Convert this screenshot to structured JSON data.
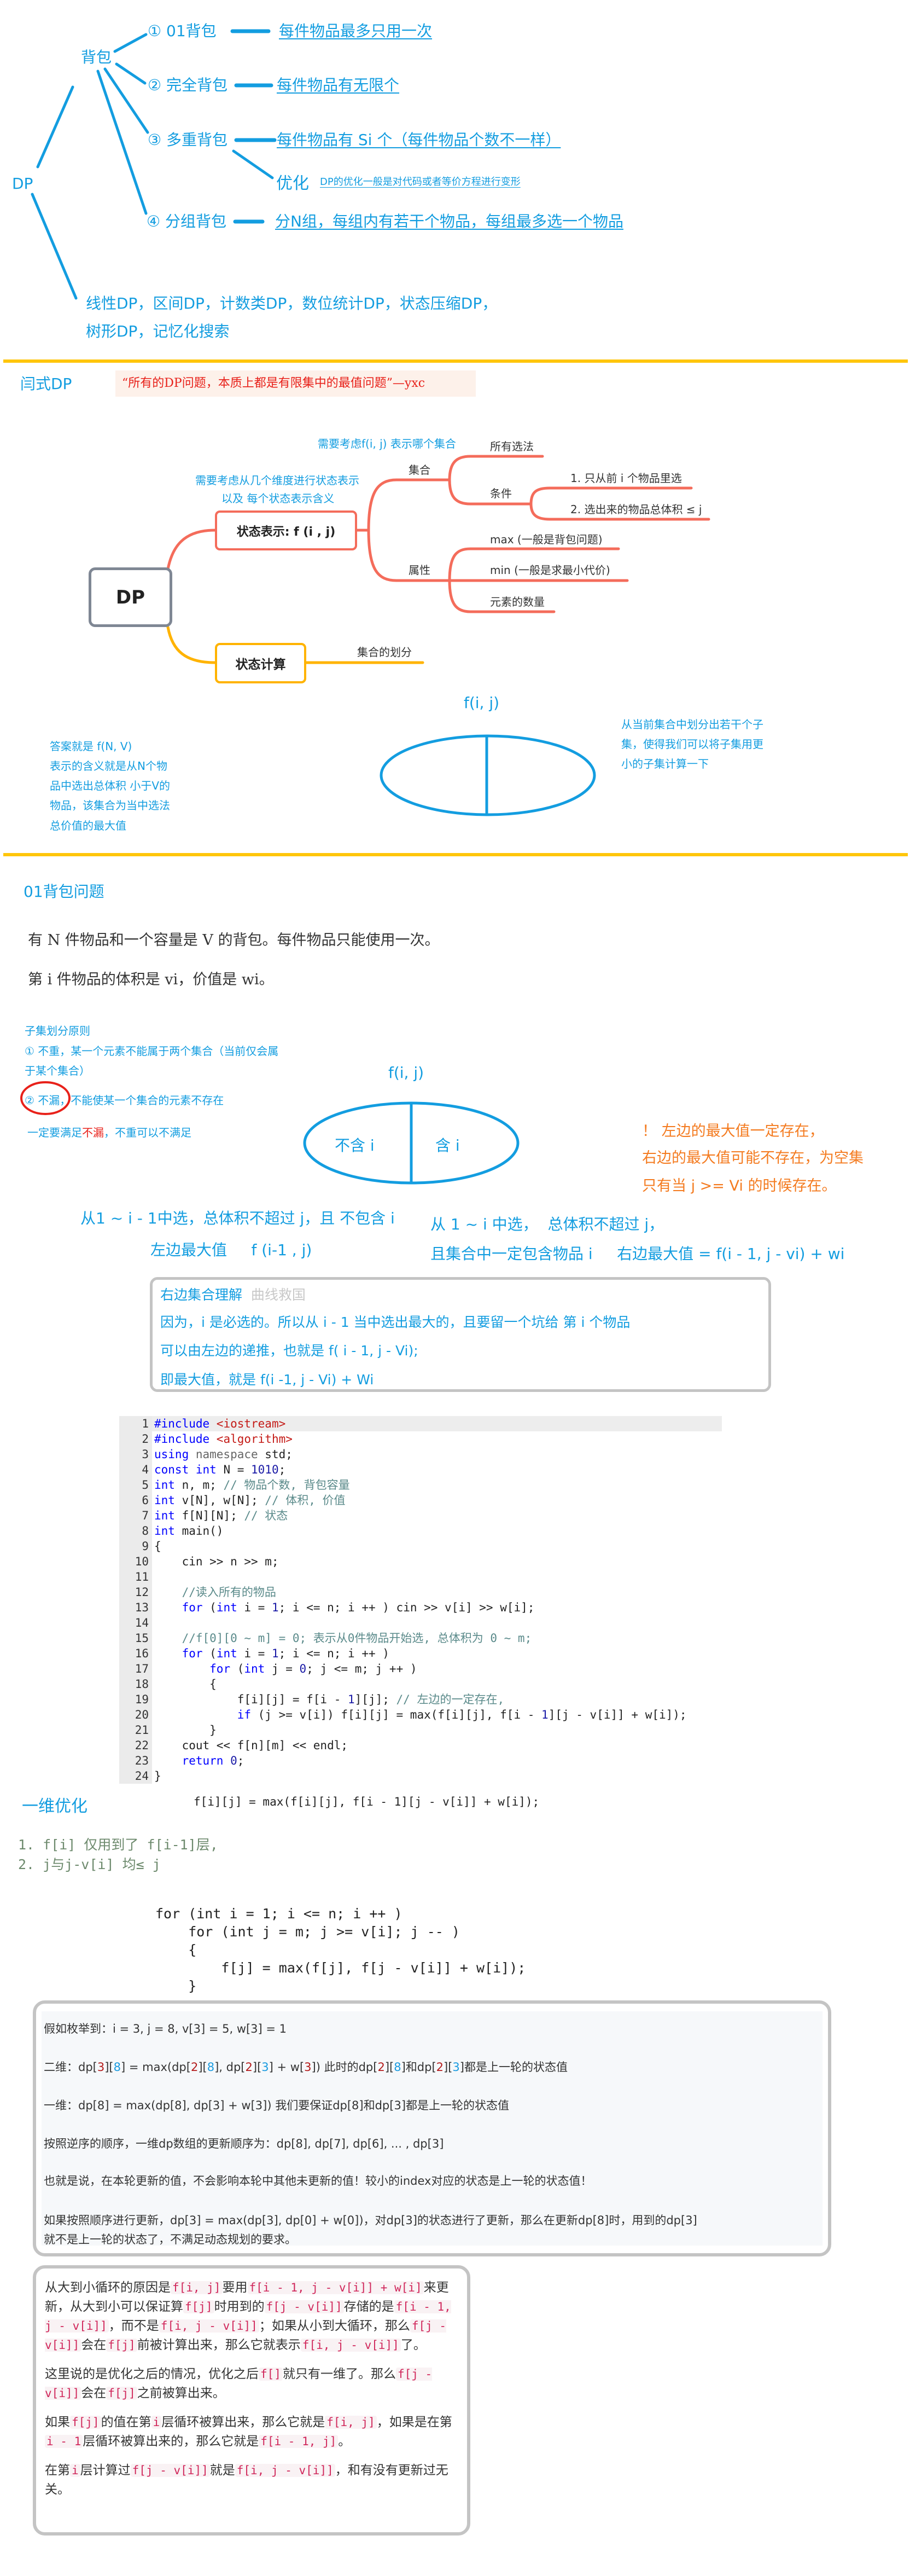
{
  "mindmap": {
    "root": "DP",
    "knapsack": "背包",
    "branches": [
      {
        "label": "① 01背包",
        "desc": "每件物品最多只用一次"
      },
      {
        "label": "② 完全背包",
        "desc": "每件物品有无限个"
      },
      {
        "label": "③ 多重背包",
        "desc": "每件物品有 Si 个（每件物品个数不一样）"
      },
      {
        "label": "④ 分组背包",
        "desc": "分N组，每组内有若干个物品，每组最多选一个物品"
      }
    ],
    "optimize": {
      "label": "优化",
      "desc": "DP的优化一般是对代码或者等价方程进行变形"
    },
    "others": [
      "线性DP，区间DP，计数类DP，数位统计DP，状态压缩DP，",
      "树形DP，记忆化搜索"
    ]
  },
  "framework": {
    "title": "闫式DP",
    "quote": "“所有的DP问题，本质上都是有限集中的最值问题”—yxc",
    "root": "DP",
    "state_repr": "状态表示: f (i , j)",
    "state_calc": "状态计算",
    "note_set": "需要考虑f(i, j) 表示哪个集合",
    "note_dims": [
      "需要考虑从几个维度进行状态表示",
      "以及 每个状态表示含义"
    ],
    "set": "集合",
    "all_choices": "所有选法",
    "condition": "条件",
    "conditions": [
      "1. 只从前 i 个物品里选",
      "2. 选出来的物品总体积 ≤ j"
    ],
    "attribute": "属性",
    "attributes": [
      "max (一般是背包问题)",
      "min (一般是求最小代价)",
      "元素的数量"
    ],
    "partition": "集合的划分",
    "fij": "f(i, j)",
    "right_note": [
      "从当前集合中划分出若干个子",
      "集，使得我们可以将子集用更",
      "小的子集计算一下"
    ],
    "left_note": [
      "答案就是 f(N, V)",
      "表示的含义就是从N个物",
      "品中选出总体积 小于V的",
      "物品，该集合为当中选法",
      "总价值的最大值"
    ],
    "colors": {
      "coral": "#f46c5b",
      "orange": "#ffb300",
      "blue": "#139de0",
      "grey": "#7f8794"
    }
  },
  "knapsack01": {
    "title": "01背包问题",
    "statement1": "有 N 件物品和一个容量是 V 的背包。每件物品只能使用一次。",
    "statement2": "第 i 件物品的体积是 vi，价值是 wi。",
    "principle_title": "子集划分原则",
    "principle1": [
      "① 不重，某一个元素不能属于两个集合（当前仅会属",
      "于某个集合）"
    ],
    "principle2": "② 不漏，不能使某一个集合的元素不存在",
    "must": {
      "a": "一定要满足",
      "b": "不漏",
      "c": "，不重可以不满足"
    },
    "fij": "f(i, j)",
    "left_part": "不含 i",
    "right_part": "含 i",
    "warn": [
      "！ 左边的最大值一定存在，",
      "右边的最大值可能不存在，为空集",
      "只有当 j >= Vi 的时候存在。"
    ],
    "left_desc": "从1 ~ i - 1中选，总体积不超过 j，且 不包含 i",
    "left_max": "左边最大值     f (i-1 , j)",
    "right_desc": "从 1 ~ i 中选，  总体积不超过 j，",
    "right_desc2": "且集合中一定包含物品 i     右边最大值 = f(i - 1, j - vi) + wi",
    "understand": {
      "title": "右边集合理解",
      "subtitle": "曲线救国",
      "lines": [
        "因为，i 是必选的。所以从 i - 1 当中选出最大的，且要留一个坑给 第 i 个物品",
        "可以由左边的递推，也就是 f( i - 1, j - Vi);",
        "即最大值，就是  f(i -1, j - Vi) + Wi"
      ]
    }
  },
  "code": [
    [
      [
        "#include ",
        "k"
      ],
      [
        "<iostream>",
        "s"
      ]
    ],
    [
      [
        "#include ",
        "k"
      ],
      [
        "<algorithm>",
        "s"
      ]
    ],
    [
      [
        "using ",
        "k"
      ],
      [
        "namespace ",
        "g"
      ],
      [
        "std;",
        "p"
      ]
    ],
    [
      [
        "const ",
        "k"
      ],
      [
        "int ",
        "k"
      ],
      [
        "N = ",
        "p"
      ],
      [
        "1010",
        "n"
      ],
      [
        ";",
        "p"
      ]
    ],
    [
      [
        "int ",
        "k"
      ],
      [
        "n, m; ",
        "p"
      ],
      [
        "// 物品个数, 背包容量",
        "c"
      ]
    ],
    [
      [
        "int ",
        "k"
      ],
      [
        "v[N], w[N]; ",
        "p"
      ],
      [
        "// 体积, 价值",
        "c"
      ]
    ],
    [
      [
        "int ",
        "k"
      ],
      [
        "f[N][N]; ",
        "p"
      ],
      [
        "// 状态",
        "c"
      ]
    ],
    [
      [
        "int ",
        "k"
      ],
      [
        "main()",
        "p"
      ]
    ],
    [
      [
        "{",
        "p"
      ]
    ],
    [
      [
        "    cin >> n >> m;",
        "p"
      ]
    ],
    [],
    [
      [
        "    //读入所有的物品",
        "c"
      ]
    ],
    [
      [
        "    ",
        "p"
      ],
      [
        "for ",
        "k"
      ],
      [
        "(",
        "p"
      ],
      [
        "int ",
        "k"
      ],
      [
        "i = ",
        "p"
      ],
      [
        "1",
        "n"
      ],
      [
        "; i <= n; i ++ ) cin >> v[i] >> w[i];",
        "p"
      ]
    ],
    [],
    [
      [
        "    //f[0][0 ~ m] = 0; 表示从0件物品开始选, 总体积为 0 ~ m;",
        "c"
      ]
    ],
    [
      [
        "    ",
        "p"
      ],
      [
        "for ",
        "k"
      ],
      [
        "(",
        "p"
      ],
      [
        "int ",
        "k"
      ],
      [
        "i = ",
        "p"
      ],
      [
        "1",
        "n"
      ],
      [
        "; i <= n; i ++ )",
        "p"
      ]
    ],
    [
      [
        "        ",
        "p"
      ],
      [
        "for ",
        "k"
      ],
      [
        "(",
        "p"
      ],
      [
        "int ",
        "k"
      ],
      [
        "j = ",
        "p"
      ],
      [
        "0",
        "n"
      ],
      [
        "; j <= m; j ++ )",
        "p"
      ]
    ],
    [
      [
        "        {",
        "p"
      ]
    ],
    [
      [
        "            f[i][j] = f[i - ",
        "p"
      ],
      [
        "1",
        "n"
      ],
      [
        "][j]; ",
        "p"
      ],
      [
        "// 左边的一定存在,",
        "c"
      ]
    ],
    [
      [
        "            ",
        "p"
      ],
      [
        "if ",
        "k"
      ],
      [
        "(j >= v[i]) f[i][j] = max(f[i][j], f[i - ",
        "p"
      ],
      [
        "1",
        "n"
      ],
      [
        "][j - v[i]] + w[i]);",
        "p"
      ]
    ],
    [
      [
        "        }",
        "p"
      ]
    ],
    [
      [
        "    cout << f[n][m] << endl;",
        "p"
      ]
    ],
    [
      [
        "    ",
        "p"
      ],
      [
        "return ",
        "k"
      ],
      [
        "0",
        "n"
      ],
      [
        ";",
        "p"
      ]
    ],
    [
      [
        "}",
        "p"
      ]
    ]
  ],
  "optimization": {
    "title": "一维优化",
    "formula": "f[i][j] = max(f[i][j], f[i - 1][j - v[i]] + w[i]);",
    "notes": [
      "1. f[i] 仅用到了 f[i-1]层,",
      "2. j与j-v[i] 均≤ j"
    ],
    "loop": [
      "for (int i = 1; i <= n; i ++ )",
      "    for (int j = m; j >= v[i]; j -- )",
      "    {",
      "        f[j] = max(f[j], f[j - v[i]] + w[i]);",
      "    }"
    ]
  },
  "example_box": {
    "lines": [
      [
        [
          "假如枚举到：i = 3, j = 8, v[3] = 5, w[3] = 1",
          ""
        ]
      ],
      [
        [
          "二维：dp[",
          ""
        ],
        [
          "3",
          "r"
        ],
        [
          "][",
          ""
        ],
        [
          "8",
          "b"
        ],
        [
          "] = max(dp[",
          ""
        ],
        [
          "2",
          "r"
        ],
        [
          "][",
          ""
        ],
        [
          "8",
          "b"
        ],
        [
          "], dp[",
          ""
        ],
        [
          "2",
          "r"
        ],
        [
          "][",
          ""
        ],
        [
          "3",
          "b"
        ],
        [
          "] + w[",
          ""
        ],
        [
          "3",
          "r"
        ],
        [
          "])    此时的dp[",
          ""
        ],
        [
          "2",
          "r"
        ],
        [
          "][",
          ""
        ],
        [
          "8",
          "b"
        ],
        [
          "]和dp[",
          ""
        ],
        [
          "2",
          "r"
        ],
        [
          "][",
          ""
        ],
        [
          "3",
          "b"
        ],
        [
          "]都是上一轮的状态值",
          ""
        ]
      ],
      [
        [
          "一维：dp[8] = max(dp[8], dp[3] + w[3])       我们要保证dp[8]和dp[3]都是上一轮的状态值",
          ""
        ]
      ],
      [
        [
          "按照逆序的顺序，一维dp数组的更新顺序为：dp[8], dp[7], dp[6], ... , dp[3]",
          ""
        ]
      ],
      [
        [
          "也就是说，在本轮更新的值，不会影响本轮中其他未更新的值！较小的index对应的状态是上一轮的状态值！",
          ""
        ]
      ],
      [
        [
          "如果按照顺序进行更新，dp[3] = max(dp[3], dp[0] + w[0])，对dp[3]的状态进行了更新，那么在更新dp[8]时，用到的dp[3]",
          ""
        ]
      ],
      [
        [
          "就不是上一轮的状态了，不满足动态规划的要求。",
          ""
        ]
      ]
    ]
  },
  "explain_box": {
    "paragraphs": [
      [
        [
          "从大到小循环的原因是",
          ""
        ],
        [
          "f[i, j]",
          "c"
        ],
        [
          "要用",
          ""
        ],
        [
          "f[i - 1, j - v[i]] + w[i]",
          "c"
        ],
        [
          "来更新，从大到小可以保证算",
          ""
        ],
        [
          "f[j]",
          "c"
        ],
        [
          "时用到的",
          ""
        ],
        [
          "f[j - v[i]]",
          "c"
        ],
        [
          "存储的是",
          ""
        ],
        [
          "f[i - 1, j - v[i]]",
          "c"
        ],
        [
          "，而不是",
          ""
        ],
        [
          "f[i, j - v[i]]",
          "c"
        ],
        [
          "；如果从小到大循环，那么",
          ""
        ],
        [
          "f[j - v[i]]",
          "c"
        ],
        [
          "会在",
          ""
        ],
        [
          "f[j]",
          "c"
        ],
        [
          "前被计算出来，那么它就表示",
          ""
        ],
        [
          "f[i, j - v[i]]",
          "c"
        ],
        [
          "了。",
          ""
        ]
      ],
      [
        [
          "这里说的是优化之后的情况，优化之后",
          ""
        ],
        [
          "f[]",
          "c"
        ],
        [
          "就只有一维了。那么",
          ""
        ],
        [
          "f[j - v[i]]",
          "c"
        ],
        [
          "会在",
          ""
        ],
        [
          "f[j]",
          "c"
        ],
        [
          "之前被算出来。",
          ""
        ]
      ],
      [
        [
          "如果",
          ""
        ],
        [
          "f[j]",
          "c"
        ],
        [
          "的值在第",
          ""
        ],
        [
          "i",
          "c"
        ],
        [
          "层循环被算出来，那么它就是",
          ""
        ],
        [
          "f[i, j]",
          "c"
        ],
        [
          "，如果是在第",
          ""
        ],
        [
          "i - 1",
          "c"
        ],
        [
          "层循环被算出来的，那么它就是",
          ""
        ],
        [
          "f[i - 1, j]",
          "c"
        ],
        [
          "。",
          ""
        ]
      ],
      [
        [
          "在第",
          ""
        ],
        [
          "i",
          "c"
        ],
        [
          "层计算过",
          ""
        ],
        [
          "f[j - v[i]]",
          "c"
        ],
        [
          "就是",
          ""
        ],
        [
          "f[i, j - v[i]]",
          "c"
        ],
        [
          "，和有没有更新过无关。",
          ""
        ]
      ]
    ]
  }
}
